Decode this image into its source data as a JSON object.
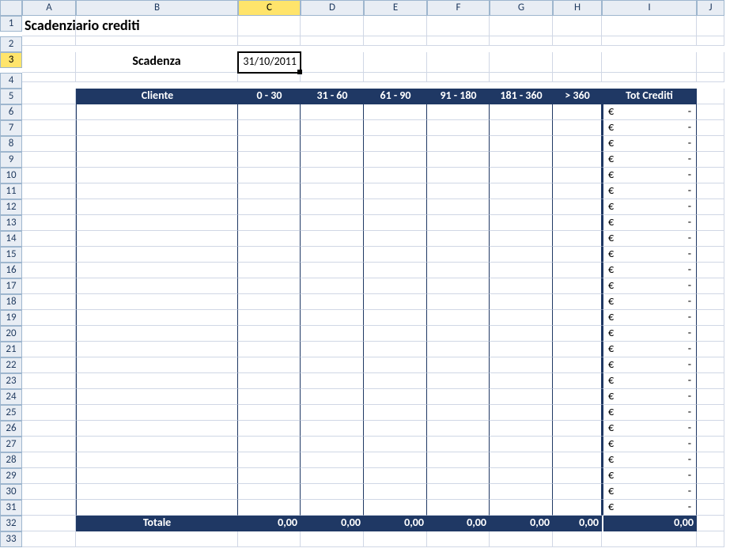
{
  "columns": [
    "A",
    "B",
    "C",
    "D",
    "E",
    "F",
    "G",
    "H",
    "I",
    "J"
  ],
  "active_col_index": 2,
  "row_count": 33,
  "active_row": 3,
  "title": "Scadenziario crediti",
  "scadenza_label": "Scadenza",
  "scadenza_value": "31/10/2011",
  "table": {
    "headers": [
      "Cliente",
      "0  -  30",
      "31 - 60",
      "61 - 90",
      "91 - 180",
      "181 - 360",
      "> 360",
      "Tot Crediti"
    ],
    "body_rows": 26,
    "currency_symbol": "€",
    "currency_value": "-",
    "totals": {
      "label": "Totale",
      "values": [
        "0,00",
        "0,00",
        "0,00",
        "0,00",
        "0,00",
        "0,00",
        "0,00"
      ]
    }
  }
}
